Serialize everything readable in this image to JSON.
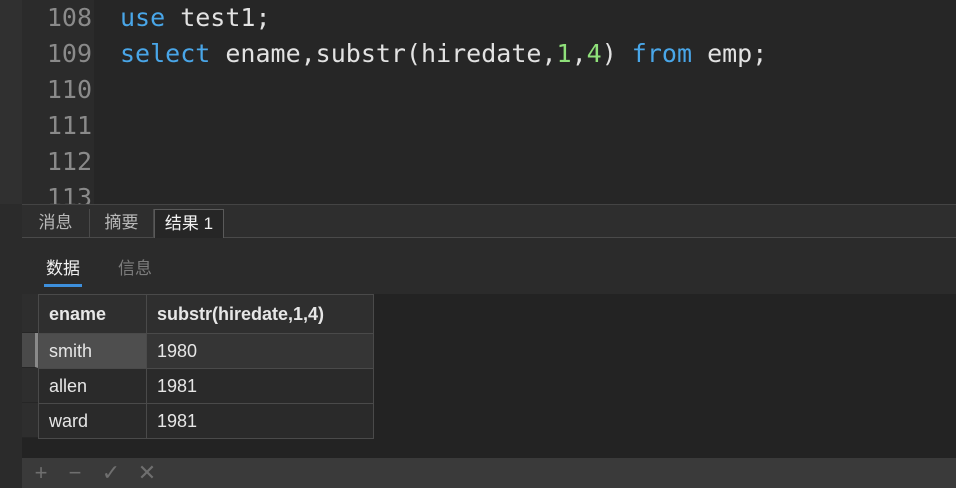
{
  "editor": {
    "lines": [
      {
        "num": "108",
        "tokens": [
          {
            "t": "use",
            "k": "kw"
          },
          {
            "t": " test1;",
            "k": "id"
          }
        ]
      },
      {
        "num": "109",
        "tokens": [
          {
            "t": "select",
            "k": "kw"
          },
          {
            "t": " ename,substr(hiredate,",
            "k": "id"
          },
          {
            "t": "1",
            "k": "num"
          },
          {
            "t": ",",
            "k": "id"
          },
          {
            "t": "4",
            "k": "num"
          },
          {
            "t": ") ",
            "k": "id"
          },
          {
            "t": "from",
            "k": "kw"
          },
          {
            "t": " emp;",
            "k": "id"
          }
        ]
      },
      {
        "num": "110",
        "tokens": []
      },
      {
        "num": "111",
        "tokens": []
      },
      {
        "num": "112",
        "tokens": []
      },
      {
        "num": "113",
        "tokens": []
      }
    ],
    "colors": {
      "keyword": "#49a6e8",
      "number": "#8fe07a",
      "text": "#e2e2e2"
    }
  },
  "tabs": [
    {
      "label": "消息",
      "active": false
    },
    {
      "label": "摘要",
      "active": false
    },
    {
      "label": "结果 1",
      "active": true
    }
  ],
  "subtabs": [
    {
      "label": "数据",
      "active": true
    },
    {
      "label": "信息",
      "active": false
    }
  ],
  "grid": {
    "columns": [
      "ename",
      "substr(hiredate,1,4)"
    ],
    "rows": [
      [
        "smith",
        "1980"
      ],
      [
        "allen",
        "1981"
      ],
      [
        "ward",
        "1981"
      ]
    ],
    "selected_row": 0
  },
  "toolbar": {
    "buttons": [
      {
        "icon": "plus-icon",
        "glyph": "+"
      },
      {
        "icon": "minus-icon",
        "glyph": "−"
      },
      {
        "icon": "check-icon",
        "glyph": "✓"
      },
      {
        "icon": "close-icon",
        "glyph": "✕"
      }
    ]
  }
}
